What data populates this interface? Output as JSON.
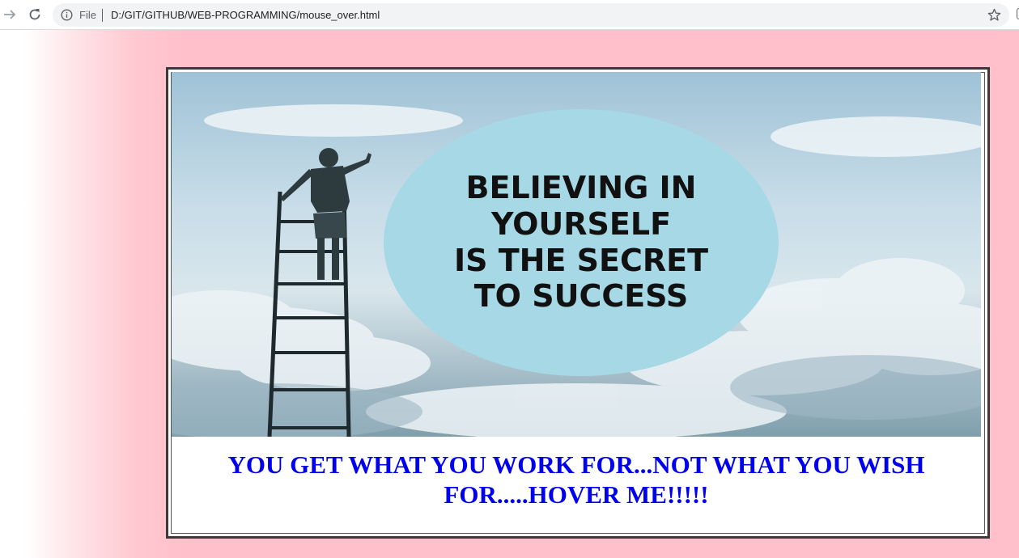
{
  "browser": {
    "scheme_label": "File",
    "url": "D:/GIT/GITHUB/WEB-PROGRAMMING/mouse_over.html"
  },
  "hero_image": {
    "headline_lines": [
      "BELIEVING IN",
      "YOURSELF",
      "IS THE SECRET",
      "TO SUCCESS"
    ]
  },
  "quote": {
    "text": "YOU GET WHAT YOU WORK FOR...NOT WHAT YOU WISH FOR.....HOVER ME!!!!!"
  },
  "colors": {
    "page_background": "#ffc0cb",
    "quote_text": "#0000ee",
    "bubble": "#a6d8e6",
    "card_border": "#3a3a3a"
  },
  "icons": [
    "forward-icon",
    "reload-icon",
    "info-icon",
    "star-icon"
  ]
}
